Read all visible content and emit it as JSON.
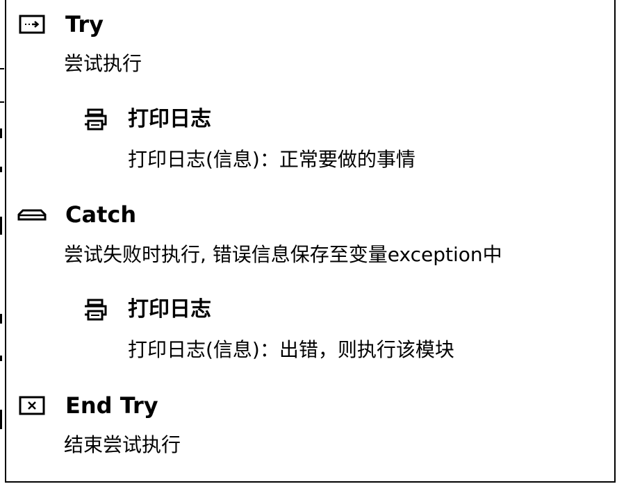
{
  "blocks": {
    "try": {
      "icon": "try-icon",
      "title": "Try",
      "description": "尝试执行"
    },
    "try_log": {
      "icon": "printer-icon",
      "title": "打印日志",
      "description": "打印日志(信息)：正常要做的事情"
    },
    "catch": {
      "icon": "catch-icon",
      "title": "Catch",
      "description": "尝试失败时执行, 错误信息保存至变量exception中"
    },
    "catch_log": {
      "icon": "printer-icon",
      "title": "打印日志",
      "description": "打印日志(信息)：出错，则执行该模块"
    },
    "end_try": {
      "icon": "end-try-icon",
      "title": "End Try",
      "description": "结束尝试执行"
    }
  }
}
